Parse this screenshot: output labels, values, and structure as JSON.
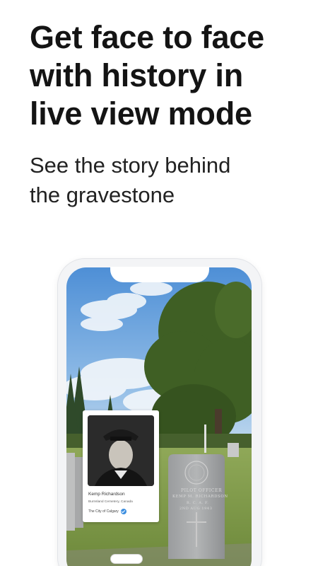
{
  "headline": {
    "line1": "Get face to face",
    "line2": "with history in",
    "line3": "live view mode"
  },
  "subhead": {
    "line1": "See the story behind",
    "line2": "the gravestone"
  },
  "card": {
    "name": "Kemp Richardson",
    "place": "Burnsland Cemetery, Canada",
    "organization": "The City of Calgary",
    "verified_icon": "verified-check-icon"
  },
  "gravestone": {
    "line1": "PILOT OFFICER",
    "line2": "KEMP M. RICHARDSON",
    "line3": "R. C. A. F.",
    "line4": "2ND AUG 1943"
  },
  "colors": {
    "headline": "#141414",
    "sky": "#6aa3dc",
    "grass": "#7e9b4a",
    "verified": "#3d8fe0"
  }
}
